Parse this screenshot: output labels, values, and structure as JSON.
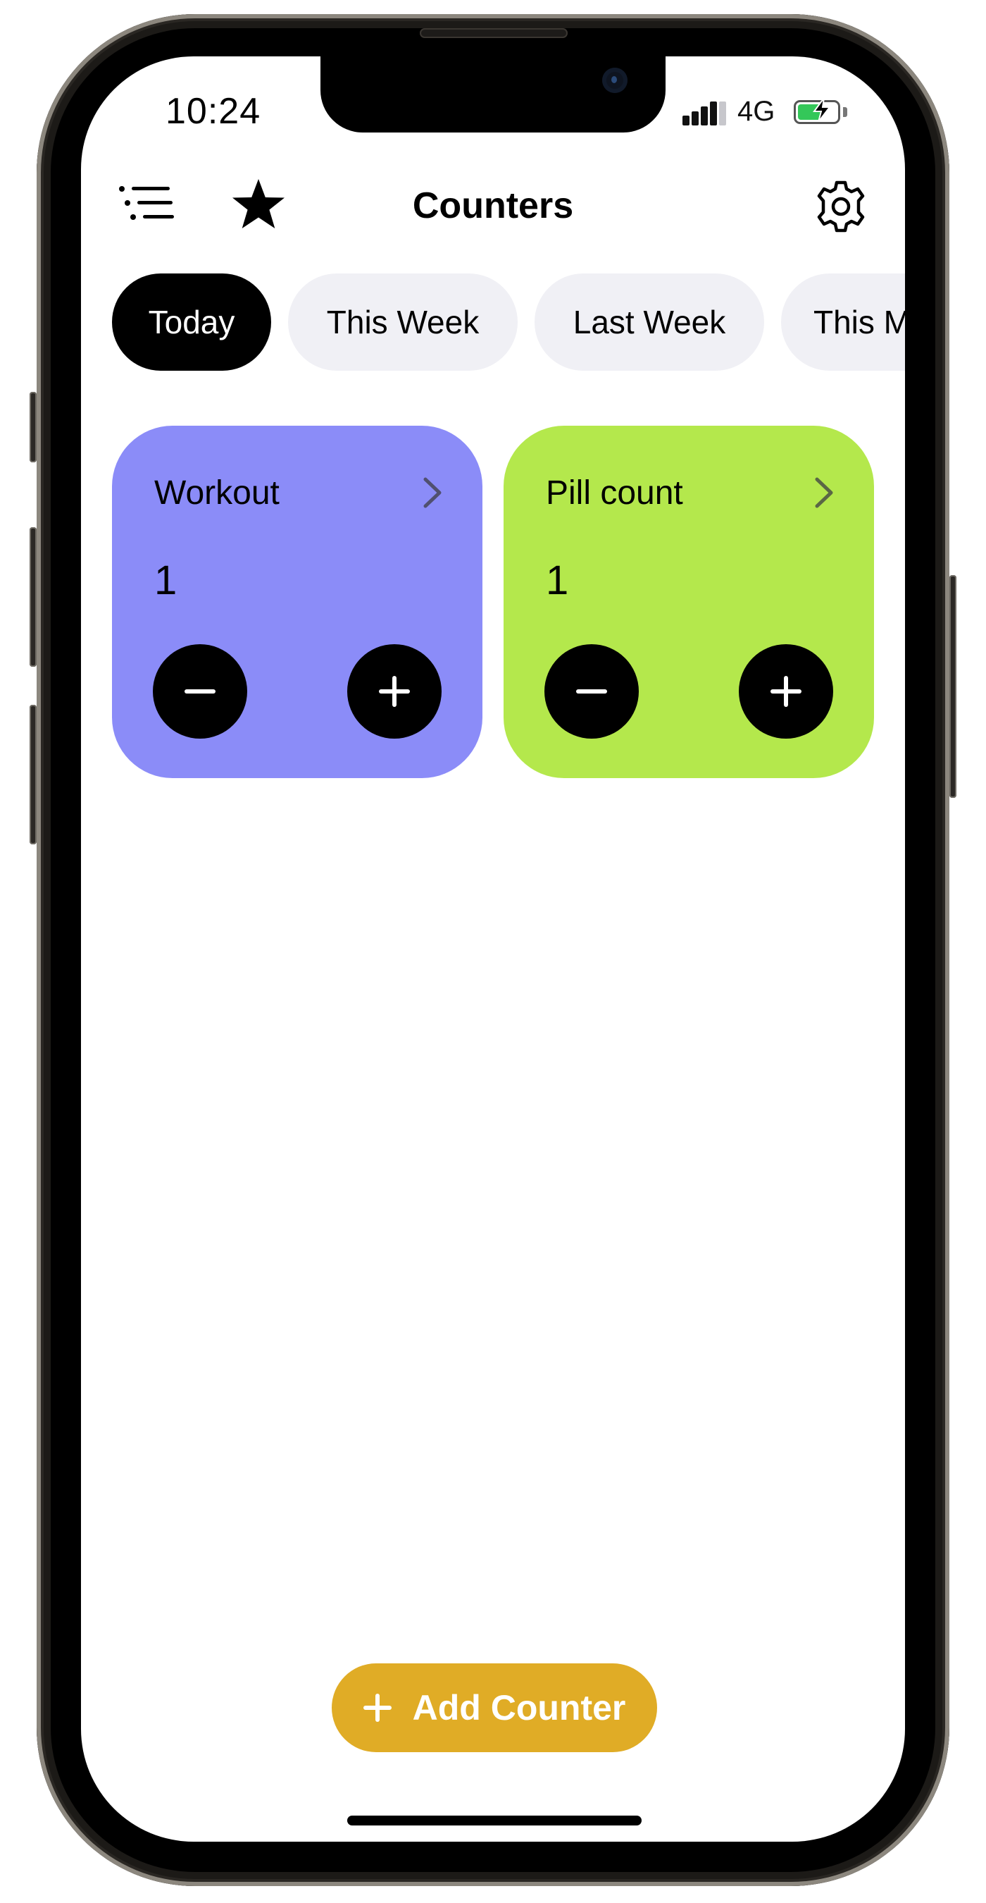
{
  "status_bar": {
    "time": "10:24",
    "network": "4G",
    "battery_color": "#34c759"
  },
  "header": {
    "title": "Counters",
    "menu_icon": "list-icon",
    "favorites_icon": "star-icon",
    "settings_icon": "gear-icon"
  },
  "tabs": [
    {
      "label": "Today",
      "active": true
    },
    {
      "label": "This Week",
      "active": false
    },
    {
      "label": "Last Week",
      "active": false
    },
    {
      "label": "This Month",
      "active": false
    }
  ],
  "counters": [
    {
      "name": "Workout",
      "value": "1",
      "color": "#8b8cf8"
    },
    {
      "name": "Pill count",
      "value": "1",
      "color": "#b4e84c"
    }
  ],
  "add_button": {
    "label": "Add Counter",
    "color": "#e0ac26"
  }
}
